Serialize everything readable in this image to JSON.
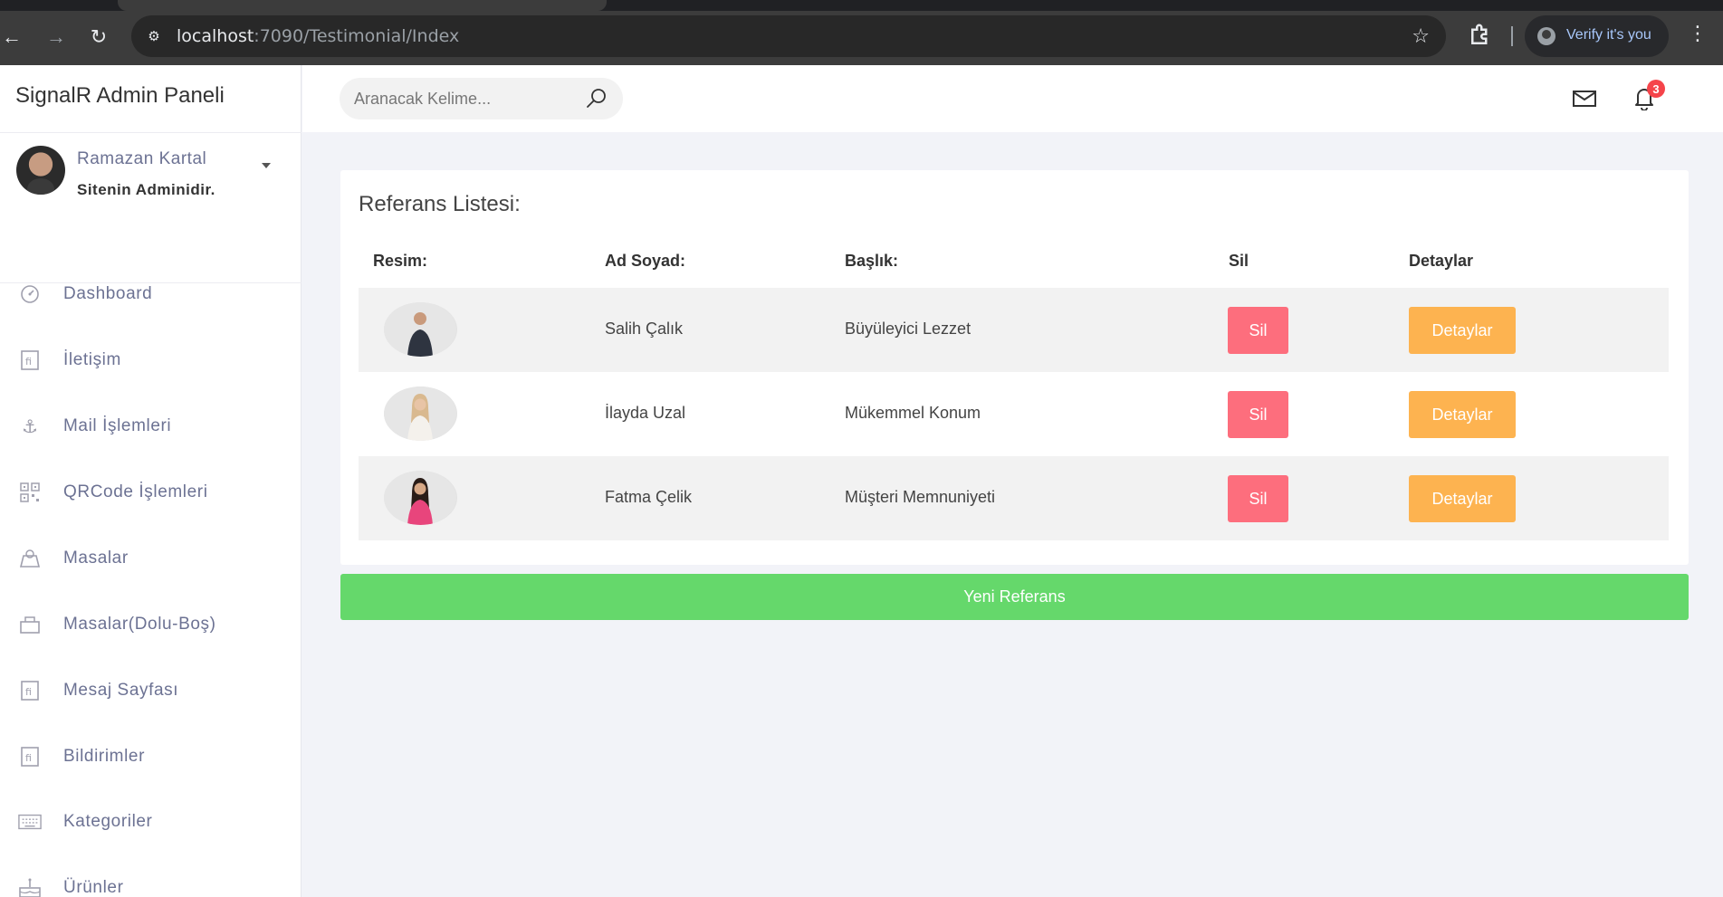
{
  "browser": {
    "url_host": "localhost",
    "url_path": ":7090/Testimonial/Index",
    "profile_label": "Verify it's you"
  },
  "sidebar": {
    "brand": "SignalR Admin Paneli",
    "user": {
      "name": "Ramazan Kartal",
      "role": "Sitenin Adminidir."
    },
    "items": [
      {
        "label": "Dashboard",
        "icon": "gauge-icon"
      },
      {
        "label": "İletişim",
        "icon": "file-icon"
      },
      {
        "label": "Mail İşlemleri",
        "icon": "anchor-icon"
      },
      {
        "label": "QRCode İşlemleri",
        "icon": "qrcode-icon"
      },
      {
        "label": "Masalar",
        "icon": "table-icon"
      },
      {
        "label": "Masalar(Dolu-Boş)",
        "icon": "table-icon"
      },
      {
        "label": "Mesaj Sayfası",
        "icon": "file-icon"
      },
      {
        "label": "Bildirimler",
        "icon": "file-icon"
      },
      {
        "label": "Kategoriler",
        "icon": "keyboard-icon"
      },
      {
        "label": "Ürünler",
        "icon": "cake-icon"
      }
    ]
  },
  "topbar": {
    "search_placeholder": "Aranacak Kelime...",
    "notification_count": "3"
  },
  "card": {
    "title": "Referans Listesi:",
    "headers": {
      "image": "Resim:",
      "name": "Ad Soyad:",
      "title": "Başlık:",
      "delete": "Sil",
      "details": "Detaylar"
    },
    "rows": [
      {
        "name": "Salih Çalık",
        "title": "Büyüleyici Lezzet",
        "delete_label": "Sil",
        "details_label": "Detaylar"
      },
      {
        "name": "İlayda Uzal",
        "title": "Mükemmel Konum",
        "delete_label": "Sil",
        "details_label": "Detaylar"
      },
      {
        "name": "Fatma Çelik",
        "title": "Müşteri Memnuniyeti",
        "delete_label": "Sil",
        "details_label": "Detaylar"
      }
    ]
  },
  "new_button_label": "Yeni Referans",
  "colors": {
    "delete": "#fd6e7d",
    "details": "#fdb350",
    "new": "#65d86b",
    "badge": "#f5444a"
  }
}
